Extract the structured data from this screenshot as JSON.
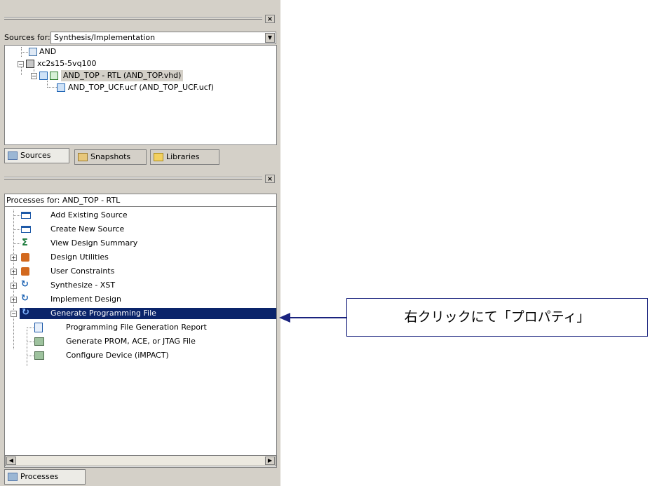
{
  "sources": {
    "for_label": "Sources for:",
    "combo_value": "Synthesis/Implementation",
    "tree": [
      {
        "label": "AND"
      },
      {
        "label": "xc2s15-5vq100"
      },
      {
        "label": "AND_TOP - RTL (AND_TOP.vhd)"
      },
      {
        "label": "AND_TOP_UCF.ucf (AND_TOP_UCF.ucf)"
      }
    ],
    "tabs": [
      {
        "label": "Sources"
      },
      {
        "label": "Snapshots"
      },
      {
        "label": "Libraries"
      }
    ]
  },
  "processes": {
    "for_label": "Processes for: AND_TOP - RTL",
    "items": [
      {
        "label": "Add Existing Source"
      },
      {
        "label": "Create New Source"
      },
      {
        "label": "View Design Summary"
      },
      {
        "label": "Design Utilities"
      },
      {
        "label": "User Constraints"
      },
      {
        "label": "Synthesize - XST"
      },
      {
        "label": "Implement Design"
      },
      {
        "label": "Generate Programming File"
      },
      {
        "label": "Programming File Generation Report"
      },
      {
        "label": "Generate PROM, ACE, or JTAG File"
      },
      {
        "label": "Configure Device (iMPACT)"
      }
    ],
    "tab": "Processes"
  },
  "callout": {
    "text": "右クリックにて「プロパティ」"
  },
  "colors": {
    "selection": "#0a246a",
    "panel": "#d4d0c8",
    "arrow": "#1a237e"
  }
}
